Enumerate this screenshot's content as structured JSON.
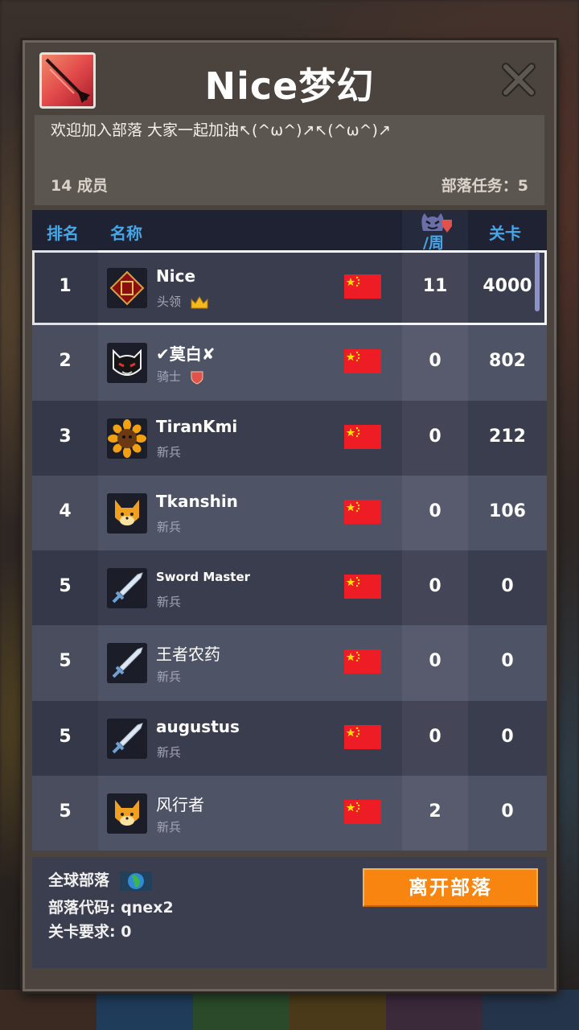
{
  "clan": {
    "title": "Nice梦幻",
    "description": "欢迎加入部落 大家一起加油↖(^ω^)↗↖(^ω^)↗",
    "members": "14 成员",
    "quests": "部落任务：5"
  },
  "table": {
    "headers": {
      "rank": "排名",
      "name": "名称",
      "week": "/周",
      "stage": "关卡"
    },
    "rows": [
      {
        "rank": "1",
        "name": "Nice",
        "role": "头领",
        "role_icon": "crown-icon",
        "avatar": "clan-emblem-avatar",
        "week": "11",
        "stage": "4000"
      },
      {
        "rank": "2",
        "name": "✔莫白✘",
        "role": "骑士",
        "role_icon": "shield-icon",
        "avatar": "demon-cat-avatar",
        "week": "0",
        "stage": "802"
      },
      {
        "rank": "3",
        "name": "TiranKmi",
        "role": "新兵",
        "avatar": "sunflower-avatar",
        "week": "0",
        "stage": "212"
      },
      {
        "rank": "4",
        "name": "Tkanshin",
        "role": "新兵",
        "avatar": "fox-avatar",
        "week": "0",
        "stage": "106"
      },
      {
        "rank": "5",
        "name": "Sword Master",
        "role": "新兵",
        "avatar": "sword-avatar",
        "week": "0",
        "stage": "0"
      },
      {
        "rank": "5",
        "name": "王者农药",
        "role": "新兵",
        "avatar": "sword-avatar",
        "week": "0",
        "stage": "0"
      },
      {
        "rank": "5",
        "name": "augustus",
        "role": "新兵",
        "avatar": "sword-avatar",
        "week": "0",
        "stage": "0"
      },
      {
        "rank": "5",
        "name": "风行者",
        "role": "新兵",
        "avatar": "fox-avatar",
        "week": "2",
        "stage": "0"
      }
    ]
  },
  "footer": {
    "global": "全球部落",
    "code": "部落代码: qnex2",
    "requirement": "关卡要求:  0",
    "leave_label": "离开部落"
  },
  "colors": {
    "accent_blue": "#47a6e6",
    "button_orange": "#f7850f",
    "flag_red": "#ee1c25"
  }
}
